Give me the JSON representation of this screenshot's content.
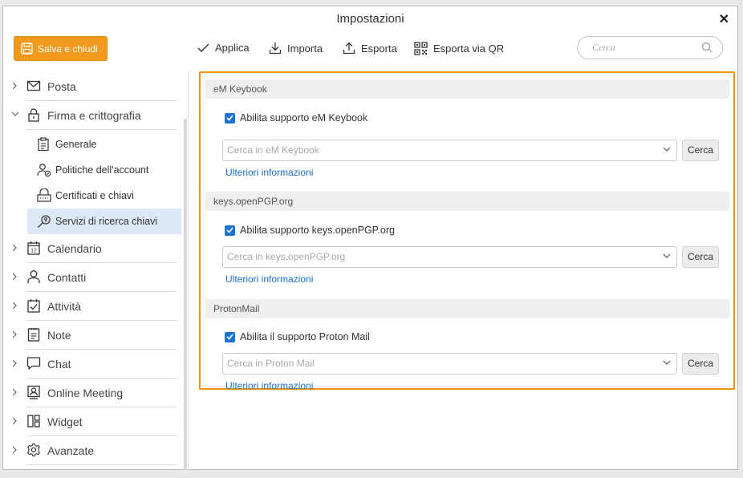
{
  "window": {
    "title": "Impostazioni"
  },
  "toolbar": {
    "save_label": "Salva e chiudi",
    "apply_label": "Applica",
    "import_label": "Importa",
    "export_label": "Esporta",
    "export_qr_label": "Esporta via QR",
    "search_placeholder": "Cerca"
  },
  "sidebar": {
    "items": [
      {
        "label": "Posta",
        "icon": "mail-icon"
      },
      {
        "label": "Firma e crittografia",
        "icon": "lock-icon",
        "expanded": true
      },
      {
        "label": "Calendario",
        "icon": "calendar-icon"
      },
      {
        "label": "Contatti",
        "icon": "person-icon"
      },
      {
        "label": "Attività",
        "icon": "task-icon"
      },
      {
        "label": "Note",
        "icon": "note-icon"
      },
      {
        "label": "Chat",
        "icon": "chat-icon"
      },
      {
        "label": "Online Meeting",
        "icon": "meeting-icon"
      },
      {
        "label": "Widget",
        "icon": "widget-icon"
      },
      {
        "label": "Avanzate",
        "icon": "gear-icon"
      }
    ],
    "subitems": [
      {
        "label": "Generale",
        "icon": "clipboard-icon"
      },
      {
        "label": "Politiche dell'account",
        "icon": "user-policy-icon"
      },
      {
        "label": "Certificati e chiavi",
        "icon": "certificate-icon"
      },
      {
        "label": "Servizi di ricerca chiavi",
        "icon": "key-search-icon",
        "active": true
      }
    ]
  },
  "sections": [
    {
      "header": "eM Keybook",
      "checkbox_label": "Abilita supporto eM Keybook",
      "checked": true,
      "combo_placeholder": "Cerca in eM Keybook",
      "button_label": "Cerca",
      "link_label": "Ulteriori informazioni"
    },
    {
      "header": "keys.openPGP.org",
      "checkbox_label": "Abilita supporto keys.openPGP.org",
      "checked": true,
      "combo_placeholder": "Cerca in keys.openPGP.org",
      "button_label": "Cerca",
      "link_label": "Ulteriori informazioni"
    },
    {
      "header": "ProtonMail",
      "checkbox_label": "Abilita il supporto Proton Mail",
      "checked": true,
      "combo_placeholder": "Cerca in Proton Mail",
      "button_label": "Cerca",
      "link_label": "Ulteriori informazioni"
    }
  ],
  "colors": {
    "accent": "#f39a1e",
    "highlight_border": "#f0940f",
    "checkbox": "#1a73d2",
    "link": "#1a6fc9",
    "active_item": "#dde9f6"
  }
}
